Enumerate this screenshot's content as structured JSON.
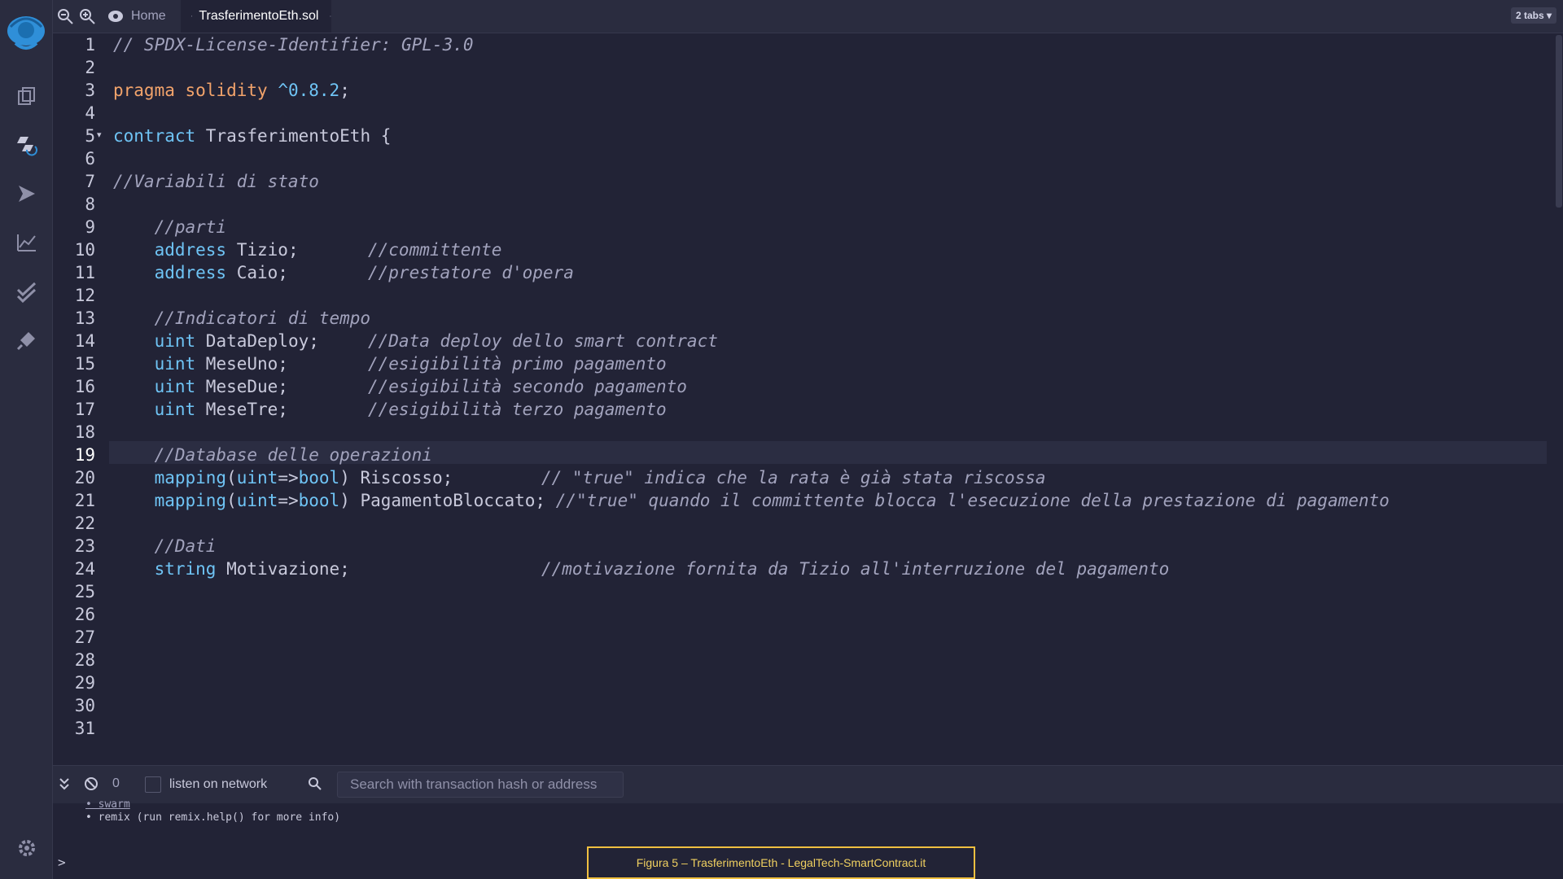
{
  "topbar": {
    "home_tab": "Home",
    "file_tab": "TrasferimentoEth.sol",
    "tabs_badge": "2 tabs ▾"
  },
  "editor": {
    "line_numbers": [
      "1",
      "2",
      "3",
      "4",
      "5",
      "6",
      "7",
      "8",
      "9",
      "10",
      "11",
      "12",
      "13",
      "14",
      "15",
      "16",
      "17",
      "18",
      "19",
      "20",
      "21",
      "22",
      "23",
      "24",
      "25",
      "26",
      "27",
      "28",
      "29",
      "30",
      "31"
    ],
    "highlighted_line": 19,
    "lines": {
      "l1": "// SPDX-License-Identifier: GPL-3.0",
      "l3_kw1": "pragma",
      "l3_kw2": "solidity",
      "l3_ver": "^0.8.2",
      "l3_end": ";",
      "l5_kw": "contract",
      "l5_rest": " TrasferimentoEth {",
      "l7": "//Variabili di stato",
      "l9": "    //parti",
      "l10_kw": "address",
      "l10_id": " Tizio;",
      "l10_cm": "//committente",
      "l11_kw": "address",
      "l11_id": " Caio;",
      "l11_cm": "//prestatore d'opera",
      "l13": "    //Indicatori di tempo",
      "l14_kw": "uint",
      "l14_id": " DataDeploy;",
      "l14_cm": "//Data deploy dello smart contract",
      "l15_kw": "uint",
      "l15_id": " MeseUno;",
      "l15_cm": "//esigibilità primo pagamento",
      "l16_kw": "uint",
      "l16_id": " MeseDue;",
      "l16_cm": "//esigibilità secondo pagamento",
      "l17_kw": "uint",
      "l17_id": " MeseTre;",
      "l17_cm": "//esigibilità terzo pagamento",
      "l19": "    //Database delle operazioni",
      "l20_kw1": "mapping",
      "l20_p1": "(",
      "l20_kw2": "uint",
      "l20_arrow": "=>",
      "l20_kw3": "bool",
      "l20_p2": ")",
      "l20_id": " Riscosso;",
      "l20_cm": "// \"true\" indica che la rata è già stata riscossa",
      "l21_kw1": "mapping",
      "l21_p1": "(",
      "l21_kw2": "uint",
      "l21_arrow": "=>",
      "l21_kw3": "bool",
      "l21_p2": ")",
      "l21_id": " PagamentoBloccato;",
      "l21_cm": " //\"true\" quando il committente blocca l'esecuzione della prestazione di pagamento",
      "l23": "    //Dati",
      "l24_kw": "string",
      "l24_id": " Motivazione;",
      "l24_cm": "//motivazione fornita da Tizio all'interruzione del pagamento"
    }
  },
  "terminal": {
    "tx_count": "0",
    "listen_label": "listen on network",
    "search_placeholder": "Search with transaction hash or address",
    "partial_line": "• swarm",
    "remix_line": "• remix (run remix.help() for more info)",
    "prompt": ">"
  },
  "caption": "Figura 5 – TrasferimentoEth - LegalTech-SmartContract.it",
  "colors": {
    "background": "#222336",
    "keyword": "#6fc4f5",
    "pragma": "#f2a36b",
    "comment": "#a2a3bd",
    "caption_border": "#f0c040"
  },
  "icons": [
    "remix-logo-icon",
    "file-explorer-icon",
    "solidity-compiler-icon",
    "deploy-run-icon",
    "analysis-icon",
    "test-icon",
    "plugin-manager-icon",
    "settings-icon",
    "zoom-out-icon",
    "zoom-in-icon",
    "home-icon",
    "close-icon"
  ]
}
